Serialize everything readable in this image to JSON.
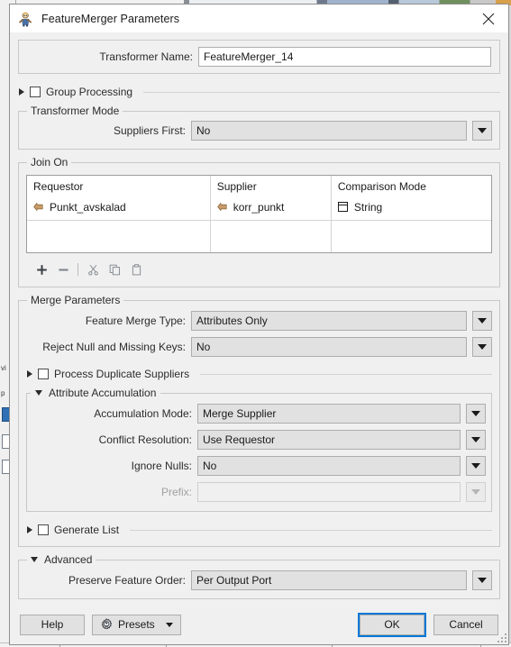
{
  "window": {
    "title": "FeatureMerger Parameters",
    "icon": "featuremerger-icon",
    "close_icon": "close-icon"
  },
  "transformer_name": {
    "label": "Transformer Name:",
    "value": "FeatureMerger_14"
  },
  "group_processing": {
    "label": "Group Processing",
    "expanded": false,
    "checked": false
  },
  "transformer_mode": {
    "title": "Transformer Mode",
    "suppliers_first": {
      "label": "Suppliers First:",
      "value": "No"
    }
  },
  "join_on": {
    "title": "Join On",
    "columns": [
      "Requestor",
      "Supplier",
      "Comparison Mode"
    ],
    "rows": [
      {
        "requestor": "Punkt_avskalad",
        "requestor_icon": "attribute-icon",
        "supplier": "korr_punkt",
        "supplier_icon": "attribute-icon",
        "comparison_mode": "String",
        "comparison_icon": "string-mode-icon"
      }
    ],
    "toolbar": [
      {
        "name": "add-row-button",
        "icon": "plus-icon"
      },
      {
        "name": "remove-row-button",
        "icon": "minus-icon"
      },
      {
        "name": "cut-button",
        "icon": "scissors-icon"
      },
      {
        "name": "copy-button",
        "icon": "copy-icon"
      },
      {
        "name": "paste-button",
        "icon": "paste-icon"
      }
    ]
  },
  "merge_parameters": {
    "title": "Merge Parameters",
    "feature_merge_type": {
      "label": "Feature Merge Type:",
      "value": "Attributes Only"
    },
    "reject_null_and_missing_keys": {
      "label": "Reject Null and Missing Keys:",
      "value": "No"
    },
    "process_duplicate_suppliers": {
      "label": "Process Duplicate Suppliers",
      "expanded": false,
      "checked": false
    },
    "attribute_accumulation": {
      "label": "Attribute Accumulation",
      "expanded": true,
      "accumulation_mode": {
        "label": "Accumulation Mode:",
        "value": "Merge Supplier"
      },
      "conflict_resolution": {
        "label": "Conflict Resolution:",
        "value": "Use Requestor"
      },
      "ignore_nulls": {
        "label": "Ignore Nulls:",
        "value": "No"
      },
      "prefix": {
        "label": "Prefix:",
        "value": "",
        "disabled": true
      }
    },
    "generate_list": {
      "label": "Generate List",
      "expanded": false,
      "checked": false
    }
  },
  "advanced": {
    "title": "Advanced",
    "expanded": true,
    "preserve_feature_order": {
      "label": "Preserve Feature Order:",
      "value": "Per Output Port"
    }
  },
  "footer": {
    "help_label": "Help",
    "presets_label": "Presets",
    "presets_icon": "presets-gear-icon",
    "ok_label": "OK",
    "cancel_label": "Cancel"
  },
  "colors": {
    "accent_focus": "#0078d7",
    "dialog_bg": "#f0f0f0",
    "control_bg": "#e1e1e1",
    "attribute_icon": "#c79b6a"
  }
}
